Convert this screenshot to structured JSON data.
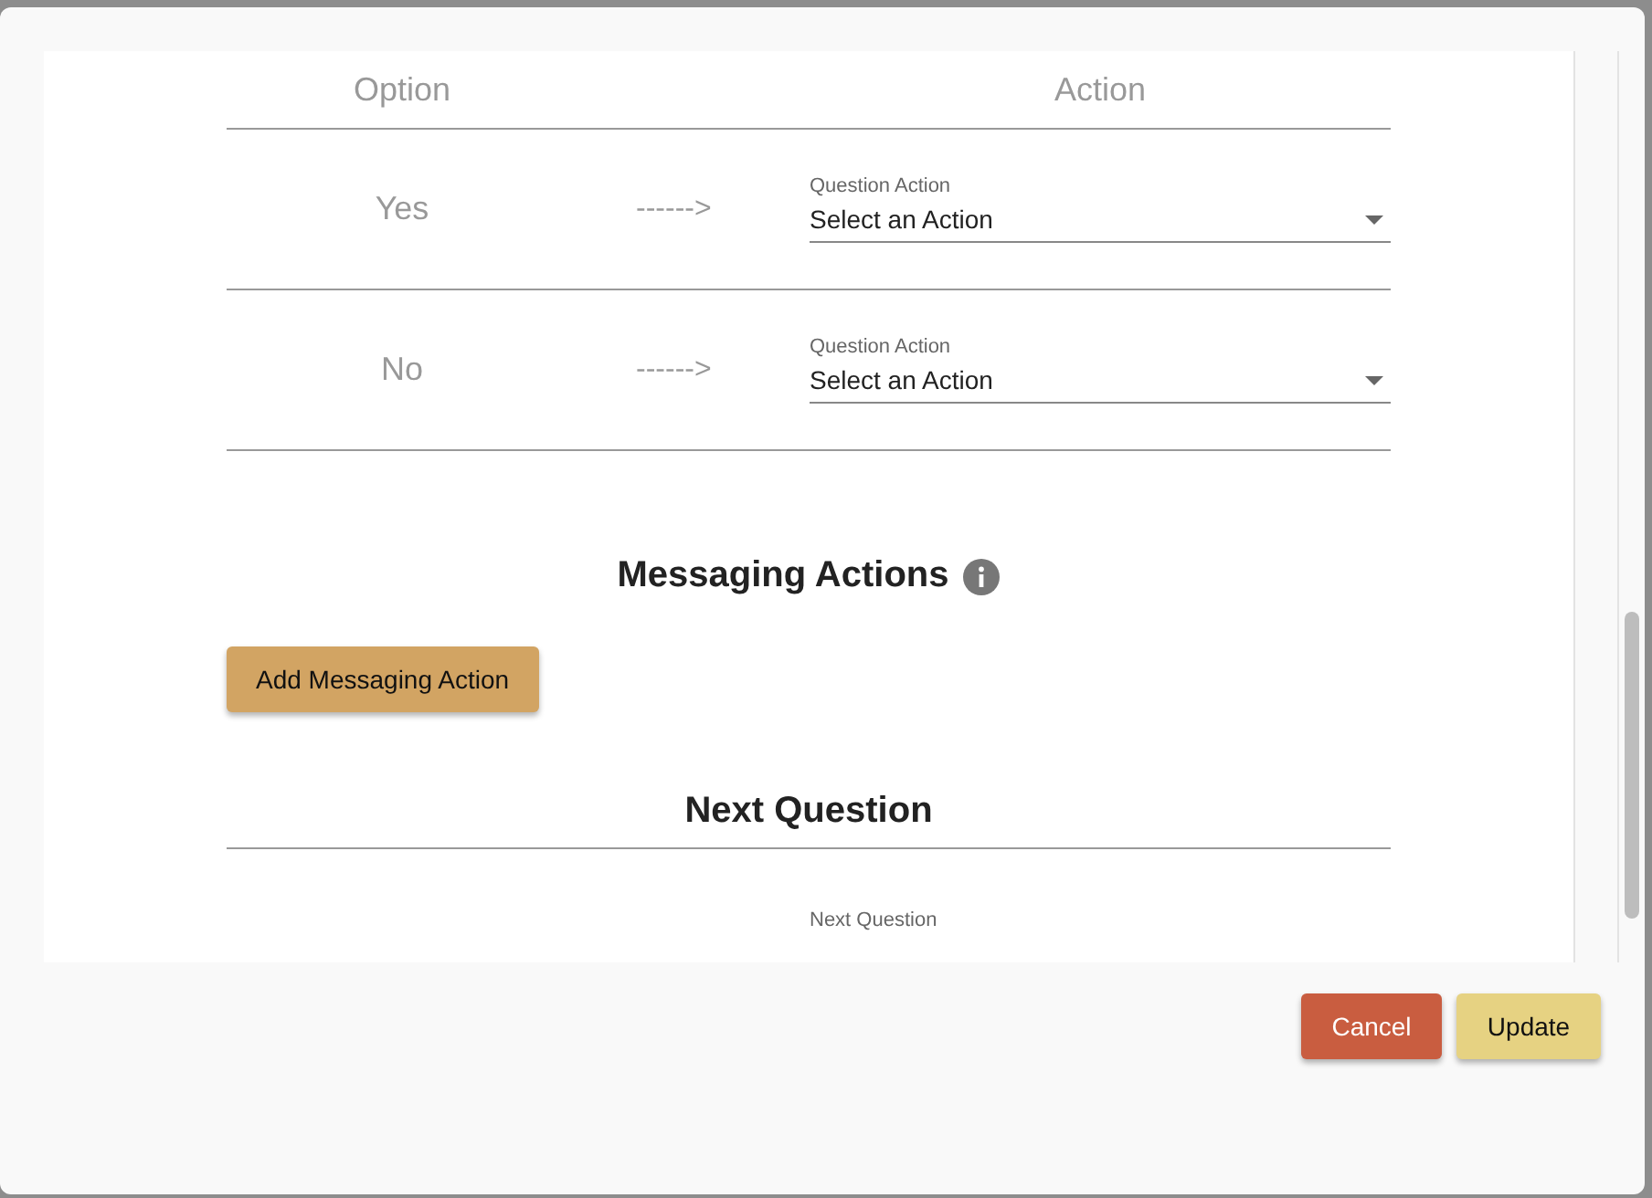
{
  "table": {
    "columns": [
      "Option",
      "Action"
    ],
    "rows": [
      {
        "option": "Yes",
        "arrow": "------>",
        "field_label": "Question Action",
        "value": "Select an Action"
      },
      {
        "option": "No",
        "arrow": "------>",
        "field_label": "Question Action",
        "value": "Select an Action"
      }
    ]
  },
  "messaging_actions": {
    "title": "Messaging Actions",
    "button": "Add Messaging Action"
  },
  "next_question": {
    "title": "Next Question",
    "field_label": "Next Question"
  },
  "footer_buttons": [
    {
      "label": "Cancel",
      "kind": "cancel"
    },
    {
      "label": "Update",
      "kind": "primary"
    }
  ]
}
